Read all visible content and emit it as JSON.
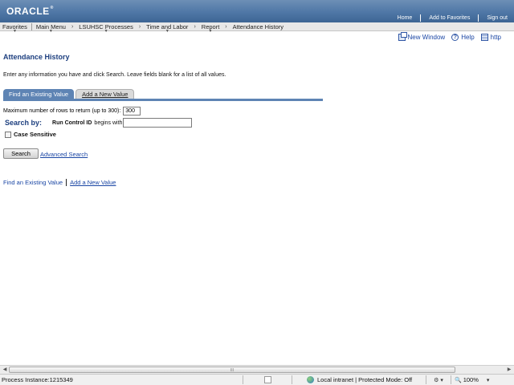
{
  "header": {
    "logo": "ORACLE",
    "logo_mark": "®",
    "links": [
      "Home",
      "Add to Favorites",
      "Sign out"
    ]
  },
  "breadcrumb": {
    "items": [
      "Favorites",
      "Main Menu",
      "LSUHSC Processes",
      "Time and Labor",
      "Report",
      "Attendance History"
    ]
  },
  "page_links": {
    "new_window": "New Window",
    "help": "Help",
    "http": "http"
  },
  "page": {
    "title": "Attendance History",
    "instructions": "Enter any information you have and click Search. Leave fields blank for a list of all values."
  },
  "tabs": {
    "find": "Find an Existing Value",
    "add": "Add a New Value"
  },
  "search": {
    "max_rows_label": "Maximum number of rows to return (up to 300):",
    "max_rows_value": "300",
    "search_by_label": "Search by:",
    "field_label": "Run Control ID",
    "operator_label": "begins with",
    "field_value": "",
    "case_sensitive_label": "Case Sensitive",
    "search_button": "Search",
    "advanced_link": "Advanced Search"
  },
  "bottom_links": {
    "find": "Find an Existing Value",
    "add": "Add a New Value"
  },
  "scrollbar": {
    "grip": "III"
  },
  "status_bar": {
    "process_text": "Process Instance:1215349",
    "zone": "Local intranet | Protected Mode: Off",
    "zoom": "100%"
  }
}
